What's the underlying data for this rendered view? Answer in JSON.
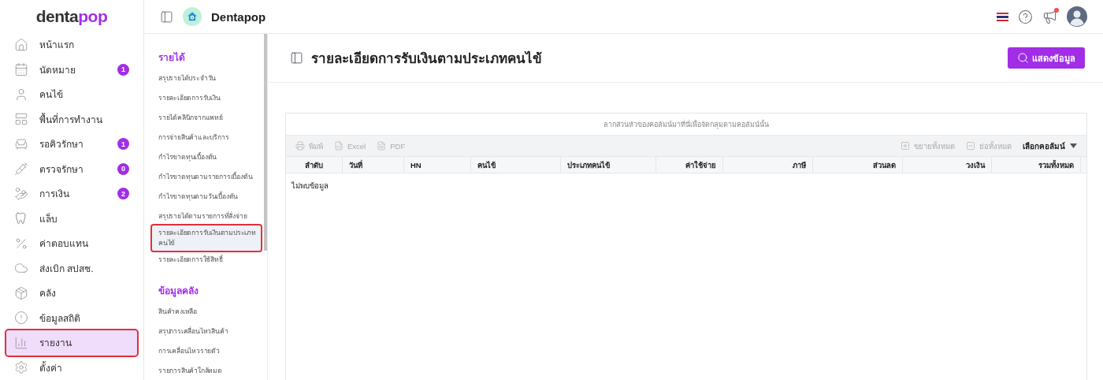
{
  "logo": {
    "dark": "denta",
    "accent": "pop"
  },
  "sidebar": {
    "items": [
      {
        "label": "หน้าแรก",
        "selected": false
      },
      {
        "label": "นัดหมาย",
        "badge": "1",
        "selected": false
      },
      {
        "label": "คนไข้",
        "selected": false
      },
      {
        "label": "พื้นที่การทำงาน",
        "selected": false
      },
      {
        "label": "รอคิวรักษา",
        "badge": "1",
        "selected": false
      },
      {
        "label": "ตรวจรักษา",
        "badge": "0",
        "selected": false
      },
      {
        "label": "การเงิน",
        "badge": "2",
        "selected": false
      },
      {
        "label": "แล็บ",
        "selected": false
      },
      {
        "label": "ค่าตอบแทน",
        "selected": false
      },
      {
        "label": "ส่งเบิก สปสช.",
        "selected": false
      },
      {
        "label": "คลัง",
        "selected": false
      },
      {
        "label": "ข้อมูลสถิติ",
        "selected": false
      },
      {
        "label": "รายงาน",
        "selected": true
      },
      {
        "label": "ตั้งค่า",
        "selected": false
      }
    ]
  },
  "header": {
    "clinic": "Dentapop"
  },
  "report_menu": {
    "sections": [
      {
        "title": "รายได้",
        "items": [
          {
            "label": "สรุปรายได้ประจำวัน",
            "selected": false
          },
          {
            "label": "รายละเอียดการรับเงิน",
            "selected": false
          },
          {
            "label": "รายได้คลินิกจากแพทย์",
            "selected": false
          },
          {
            "label": "การจ่ายสินค้าและบริการ",
            "selected": false
          },
          {
            "label": "กำไรขาดทุนเบื้องต้น",
            "selected": false
          },
          {
            "label": "กำไรขาดทุนตามรายการเบื้องต้น",
            "selected": false
          },
          {
            "label": "กำไรขาดทุนตามวันเบื้องต้น",
            "selected": false
          },
          {
            "label": "สรุปรายได้ตามรายการที่สั่งจ่าย",
            "selected": false
          },
          {
            "label": "รายละเอียดการรับเงินตามประเภทคนไข้",
            "selected": true
          },
          {
            "label": "รายละเอียดการใช้สิทธิ์",
            "selected": false
          }
        ]
      },
      {
        "title": "ข้อมูลคลัง",
        "items": [
          {
            "label": "สินค้าคงเหลือ",
            "selected": false
          },
          {
            "label": "สรุปการเคลื่อนไหวสินค้า",
            "selected": false
          },
          {
            "label": "การเคลื่อนไหวรายตัว",
            "selected": false
          },
          {
            "label": "รายการสินค้าใกล้หมด",
            "selected": false
          }
        ]
      }
    ]
  },
  "page": {
    "title": "รายละเอียดการรับเงินตามประเภทคนไข้",
    "show_button": "แสดงข้อมูล"
  },
  "grid": {
    "group_hint": "ลากส่วนหัวของคอลัมน์มาที่นี่เพื่อจัดกลุ่มตามคอลัมน์นั้น",
    "toolbar_left": [
      {
        "label": "พิมพ์",
        "disabled": true
      },
      {
        "label": "Excel",
        "disabled": true
      },
      {
        "label": "PDF",
        "disabled": true
      }
    ],
    "toolbar_right": [
      {
        "label": "ขยายทั้งหมด",
        "disabled": true
      },
      {
        "label": "ย่อทั้งหมด",
        "disabled": true
      }
    ],
    "column_chooser": "เลือกคอลัมน์",
    "columns": [
      {
        "label": "ลำดับ",
        "kind": "index"
      },
      {
        "label": "วันที่",
        "kind": "text"
      },
      {
        "label": "HN",
        "kind": "text"
      },
      {
        "label": "คนไข้",
        "kind": "text"
      },
      {
        "label": "ประเภทคนไข้",
        "kind": "text"
      },
      {
        "label": "ค่าใช้จ่าย",
        "kind": "number"
      },
      {
        "label": "ภาษี",
        "kind": "number"
      },
      {
        "label": "ส่วนลด",
        "kind": "number"
      },
      {
        "label": "วงเงิน",
        "kind": "number"
      },
      {
        "label": "รวมทั้งหมด",
        "kind": "number"
      }
    ],
    "empty": "ไม่พบข้อมูล"
  }
}
